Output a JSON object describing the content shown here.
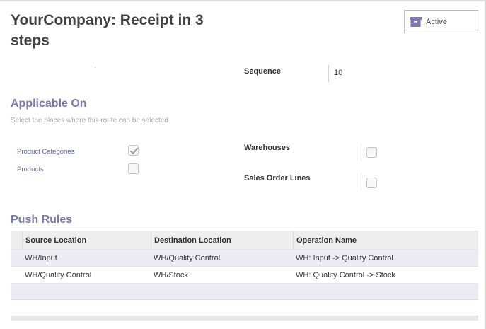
{
  "form": {
    "title": "YourCompany: Receipt in 3 steps",
    "active_label": "Active",
    "sequence_label": "Sequence",
    "sequence_value": "10"
  },
  "applicable_on": {
    "title": "Applicable On",
    "hint": "Select the places where this route can be selected",
    "product_categories_label": "Product Categories",
    "product_categories_checked": true,
    "products_label": "Products",
    "products_checked": false,
    "warehouses_label": "Warehouses",
    "warehouses_checked": false,
    "sales_order_lines_label": "Sales Order Lines",
    "sales_order_lines_checked": false
  },
  "push_rules": {
    "title": "Push Rules",
    "columns": [
      "Source Location",
      "Destination Location",
      "Operation Name"
    ],
    "rows": [
      {
        "source": "WH/Input",
        "destination": "WH/Quality Control",
        "operation": "WH: Input -> Quality Control"
      },
      {
        "source": "WH/Quality Control",
        "destination": "WH/Stock",
        "operation": "WH: Quality Control -> Stock"
      }
    ]
  },
  "colors": {
    "accent": "#7c7bad",
    "label_blue": "#5f6aa3",
    "row_highlight": "#ebebf6"
  },
  "icons": {
    "active_button": "archive-icon",
    "checked": "checkmark-icon"
  }
}
